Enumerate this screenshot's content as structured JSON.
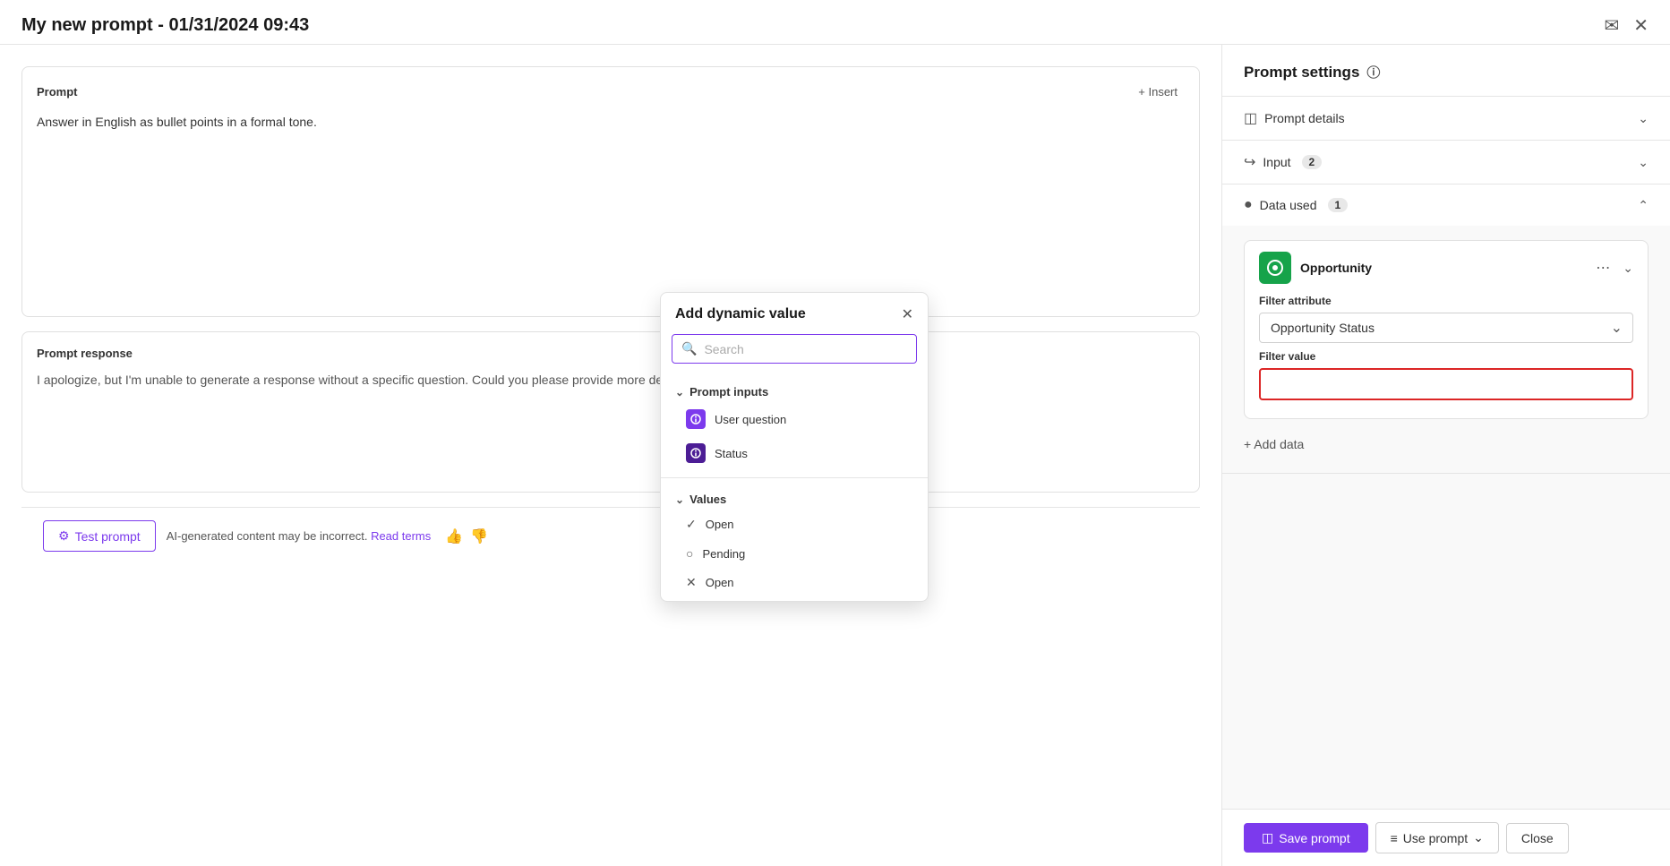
{
  "titleBar": {
    "title": "My new prompt - 01/31/2024 09:43"
  },
  "leftPanel": {
    "promptBox": {
      "title": "Prompt",
      "insertLabel": "+ Insert",
      "promptText": "Answer in English as bullet points in a formal tone."
    },
    "responseBox": {
      "title": "Prompt response",
      "responseText": "I apologize, but I'm unable to generate a response without a specific question. Could you please provide more de..."
    },
    "bottomBar": {
      "testPromptLabel": "Test prompt",
      "disclaimer": "AI-generated content may be incorrect.",
      "readTermsLabel": "Read terms"
    }
  },
  "rightPanel": {
    "title": "Prompt settings",
    "sections": {
      "promptDetails": {
        "label": "Prompt details"
      },
      "input": {
        "label": "Input",
        "badge": "2"
      },
      "dataUsed": {
        "label": "Data used",
        "badge": "1",
        "opportunity": {
          "name": "Opportunity",
          "filterAttributeLabel": "Filter attribute",
          "filterAttributeValue": "Opportunity Status",
          "filterValueLabel": "Filter value",
          "filterValuePlaceholder": ""
        },
        "addDataLabel": "+ Add data"
      }
    },
    "bottomBar": {
      "savePromptLabel": "Save prompt",
      "usePromptLabel": "Use prompt",
      "closeLabel": "Close"
    }
  },
  "dropdown": {
    "title": "Add dynamic value",
    "search": {
      "placeholder": "Search"
    },
    "promptInputs": {
      "sectionLabel": "Prompt inputs",
      "items": [
        {
          "label": "User question"
        },
        {
          "label": "Status"
        }
      ]
    },
    "values": {
      "sectionLabel": "Values",
      "items": [
        {
          "label": "Open",
          "icon": "check"
        },
        {
          "label": "Pending",
          "icon": "clock"
        },
        {
          "label": "Open",
          "icon": "x"
        }
      ]
    }
  }
}
